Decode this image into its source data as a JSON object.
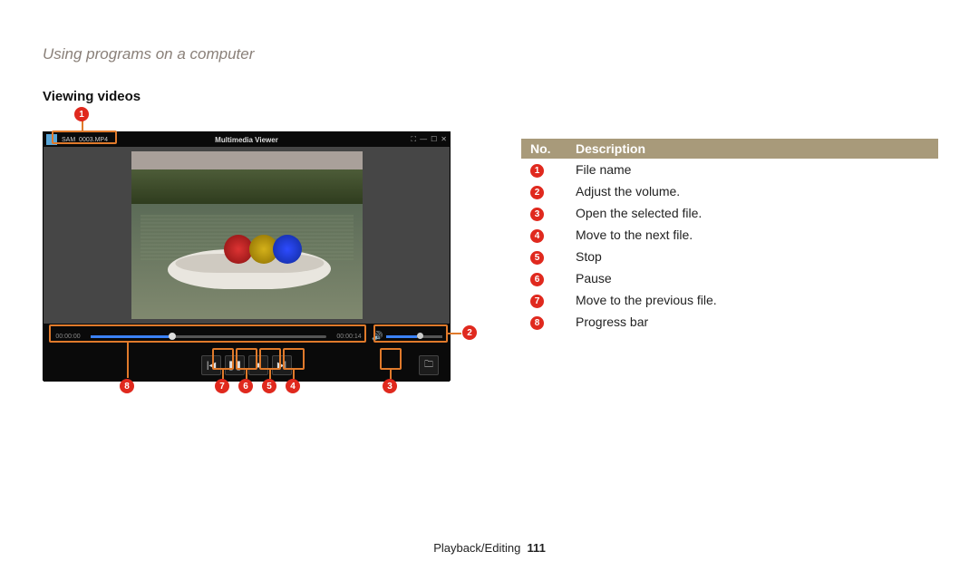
{
  "page": {
    "breadcrumb": "Using programs on a computer",
    "section": "Viewing videos",
    "footer_chapter": "Playback/Editing",
    "footer_page": "111"
  },
  "player": {
    "filename": "SAM_0003.MP4",
    "window_title": "Multimedia Viewer",
    "time_current": "00:00:00",
    "time_total": "00:00:14"
  },
  "callouts": [
    "1",
    "2",
    "3",
    "4",
    "5",
    "6",
    "7",
    "8"
  ],
  "table": {
    "head_no": "No.",
    "head_desc": "Description",
    "rows": [
      {
        "n": "1",
        "d": "File name"
      },
      {
        "n": "2",
        "d": "Adjust the volume."
      },
      {
        "n": "3",
        "d": "Open the selected file."
      },
      {
        "n": "4",
        "d": "Move to the next file."
      },
      {
        "n": "5",
        "d": "Stop"
      },
      {
        "n": "6",
        "d": "Pause"
      },
      {
        "n": "7",
        "d": "Move to the previous file."
      },
      {
        "n": "8",
        "d": "Progress bar"
      }
    ]
  }
}
